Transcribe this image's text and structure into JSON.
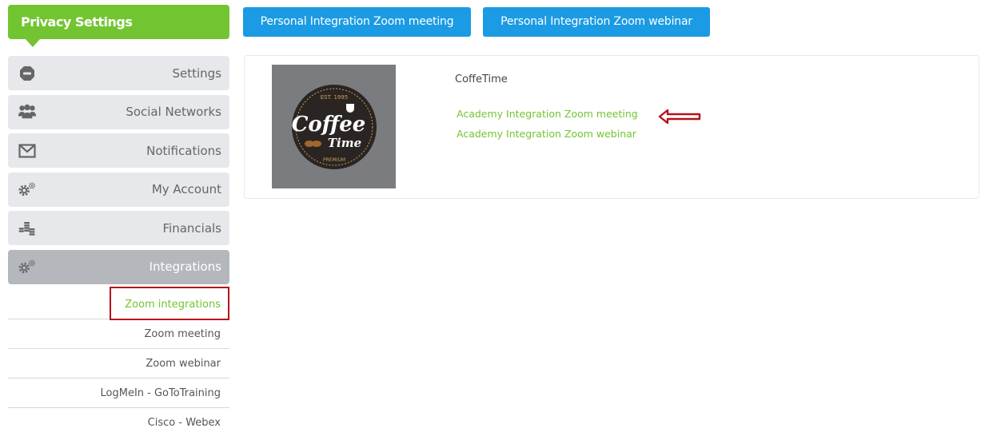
{
  "sidebar": {
    "title": "Privacy Settings",
    "menu": [
      {
        "label": "Settings",
        "icon": "no-entry-icon",
        "active": false
      },
      {
        "label": "Social Networks",
        "icon": "users-icon",
        "active": false
      },
      {
        "label": "Notifications",
        "icon": "envelope-icon",
        "active": false
      },
      {
        "label": "My Account",
        "icon": "gears-icon",
        "active": false
      },
      {
        "label": "Financials",
        "icon": "coins-icon",
        "active": false
      },
      {
        "label": "Integrations",
        "icon": "gears-icon",
        "active": true
      }
    ],
    "submenu": [
      {
        "label": "Zoom integrations",
        "active": true
      },
      {
        "label": "Zoom meeting",
        "active": false
      },
      {
        "label": "Zoom webinar",
        "active": false
      },
      {
        "label": "LogMeIn - GoToTraining",
        "active": false
      },
      {
        "label": "Cisco - Webex",
        "active": false
      }
    ]
  },
  "toolbar": {
    "personal_meeting_label": "Personal Integration Zoom meeting",
    "personal_webinar_label": "Personal Integration Zoom webinar"
  },
  "card": {
    "company_name": "CoffeTime",
    "logo": {
      "line1": "Coffee",
      "line2": "Time",
      "top_text": "EST. 1995",
      "bottom_text": "PREMIUM"
    },
    "links": [
      {
        "label": "Academy Integration Zoom meeting"
      },
      {
        "label": "Academy Integration Zoom webinar"
      }
    ]
  },
  "colors": {
    "brand_green": "#72c531",
    "button_blue": "#1a9be4",
    "highlight_red": "#b5121b"
  }
}
